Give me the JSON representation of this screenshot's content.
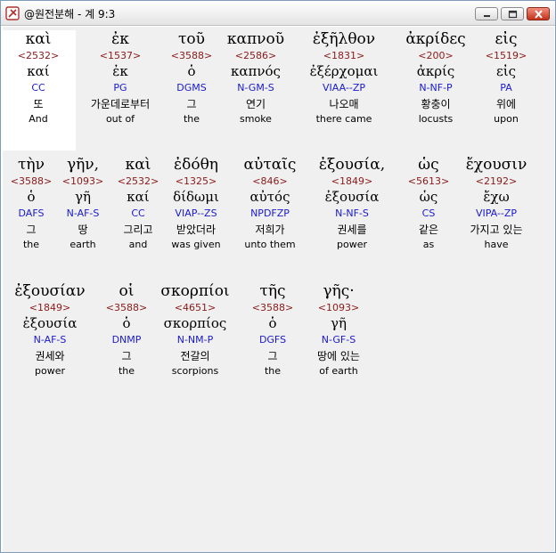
{
  "window": {
    "title": "@원전분해 - 계 9:3",
    "icon": "bible-app-icon",
    "buttons": [
      "minimize-icon",
      "maximize-icon",
      "close-icon"
    ]
  },
  "lines": [
    [
      {
        "greek": "καὶ",
        "strong": "<2532>",
        "lemma": "καί",
        "parse": "CC",
        "korean": "또",
        "english": "And",
        "selected": true
      },
      {
        "greek": "ἐκ",
        "strong": "<1537>",
        "lemma": "ἐκ",
        "parse": "PG",
        "korean": "가운데로부터",
        "english": "out of"
      },
      {
        "greek": "τοῦ",
        "strong": "<3588>",
        "lemma": "ὁ",
        "parse": "DGMS",
        "korean": "그",
        "english": "the"
      },
      {
        "greek": "καπνοῦ",
        "strong": "<2586>",
        "lemma": "καπνός",
        "parse": "N-GM-S",
        "korean": "연기",
        "english": "smoke"
      },
      {
        "greek": "ἐξῆλθον",
        "strong": "<1831>",
        "lemma": "ἐξέρχομαι",
        "parse": "VIAA--ZP",
        "korean": "나오매",
        "english": "there came"
      },
      {
        "greek": "ἀκρίδες",
        "strong": "<200>",
        "lemma": "ἀκρίς",
        "parse": "N-NF-P",
        "korean": "황충이",
        "english": "locusts"
      },
      {
        "greek": "εἰς",
        "strong": "<1519>",
        "lemma": "εἰς",
        "parse": "PA",
        "korean": "위에",
        "english": "upon"
      }
    ],
    [
      {
        "greek": "τὴν",
        "strong": "<3588>",
        "lemma": "ὁ",
        "parse": "DAFS",
        "korean": "그",
        "english": "the"
      },
      {
        "greek": "γῆν,",
        "strong": "<1093>",
        "lemma": "γῆ",
        "parse": "N-AF-S",
        "korean": "땅",
        "english": "earth"
      },
      {
        "greek": "καὶ",
        "strong": "<2532>",
        "lemma": "καί",
        "parse": "CC",
        "korean": "그리고",
        "english": "and"
      },
      {
        "greek": "ἐδόθη",
        "strong": "<1325>",
        "lemma": "δίδωμι",
        "parse": "VIAP--ZS",
        "korean": "받았더라",
        "english": "was given"
      },
      {
        "greek": "αὐταῖς",
        "strong": "<846>",
        "lemma": "αὐτός",
        "parse": "NPDFZP",
        "korean": "저희가",
        "english": "unto them"
      },
      {
        "greek": "ἐξουσία,",
        "strong": "<1849>",
        "lemma": "ἐξουσία",
        "parse": "N-NF-S",
        "korean": "권세를",
        "english": "power"
      },
      {
        "greek": "ὡς",
        "strong": "<5613>",
        "lemma": "ὡς",
        "parse": "CS",
        "korean": "같은",
        "english": "as"
      },
      {
        "greek": "ἔχουσιν",
        "strong": "<2192>",
        "lemma": "ἔχω",
        "parse": "VIPA--ZP",
        "korean": "가지고 있는",
        "english": "have"
      }
    ],
    [
      {
        "greek": "ἐξουσίαν",
        "strong": "<1849>",
        "lemma": "ἐξουσία",
        "parse": "N-AF-S",
        "korean": "권세와",
        "english": "power"
      },
      {
        "greek": "οἱ",
        "strong": "<3588>",
        "lemma": "ὁ",
        "parse": "DNMP",
        "korean": "그",
        "english": "the"
      },
      {
        "greek": "σκορπίοι",
        "strong": "<4651>",
        "lemma": "σκορπίος",
        "parse": "N-NM-P",
        "korean": "전갈의",
        "english": "scorpions"
      },
      {
        "greek": "τῆς",
        "strong": "<3588>",
        "lemma": "ὁ",
        "parse": "DGFS",
        "korean": "그",
        "english": "the"
      },
      {
        "greek": "γῆς·",
        "strong": "<1093>",
        "lemma": "γῆ",
        "parse": "N-GF-S",
        "korean": "땅에 있는",
        "english": "of earth"
      }
    ]
  ]
}
